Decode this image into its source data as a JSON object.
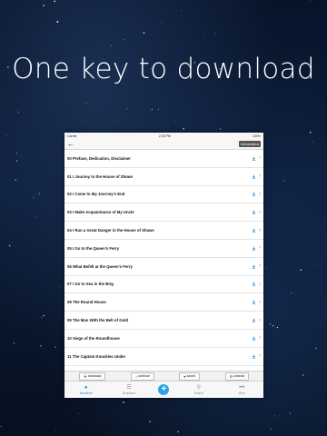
{
  "headline": "One key to download",
  "status_bar": {
    "carrier": "Carrier",
    "time": "2:35 PM",
    "battery": "100%"
  },
  "nav": {
    "information_label": "Information"
  },
  "chapters": [
    "00 Preface, Dedication, Disclaimer",
    "01 I Journey to the House of Shaws",
    "02 I Come to My Journey's End",
    "03 I Make Acquaintance of My Uncle",
    "04 I Run a Great Danger in the House of Shaws",
    "05 I Go to the Queen's Ferry",
    "06 What Befell at the Queen's Ferry",
    "07 I Go to Sea in the Brig",
    "08 The Round House",
    "09 The Man With the Belt of Gold",
    "10 Siege of the Roundhouse",
    "11 The Captain Knuckles Under"
  ],
  "action_bar": {
    "download": "download",
    "continue": "continue",
    "saved": "saved",
    "contract": "contract"
  },
  "tabs": {
    "bookshelf": "Bookshelf",
    "bookstore": "Bookstore",
    "search": "Search",
    "more": "More"
  },
  "colors": {
    "accent": "#2a8ad4",
    "plus": "#2aa5e6"
  }
}
